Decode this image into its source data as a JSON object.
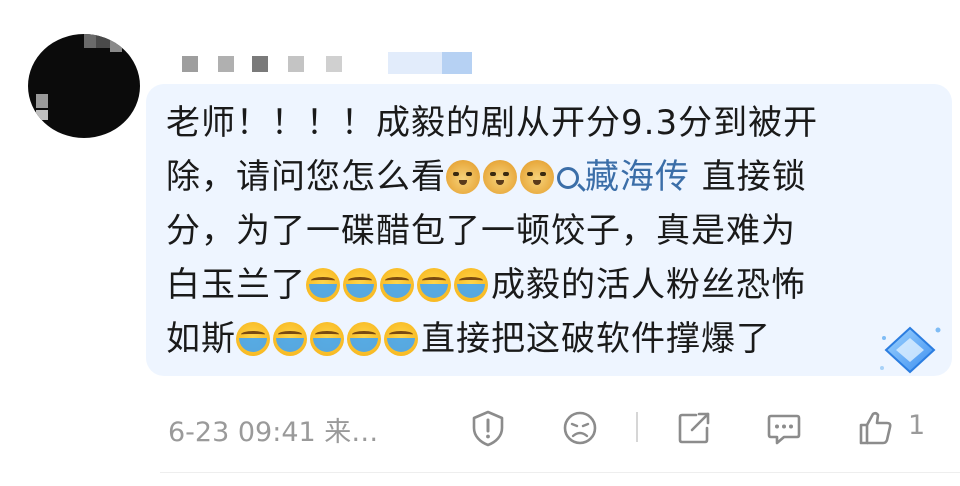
{
  "comment": {
    "line1": "老师！！！！成毅的剧从开分9.3分到被开",
    "line2a": "除，请问您怎么看",
    "topic": "藏海传",
    "line2b": " 直接锁",
    "line3": "分，为了一碟醋包了一顿饺子，真是难为",
    "line4a": "白玉兰了",
    "line4b": "成毅的活人粉丝恐怖",
    "line5a": "如斯",
    "line5b": "直接把这破软件撑爆了",
    "emojis": {
      "after_line2a": [
        "doge-icon",
        "doge-icon",
        "doge-icon"
      ],
      "after_line4a": [
        "cry-laugh-icon",
        "cry-laugh-icon",
        "cry-laugh-icon",
        "cry-laugh-icon",
        "cry-laugh-icon"
      ],
      "after_line5a": [
        "cry-laugh-icon",
        "cry-laugh-icon",
        "cry-laugh-icon",
        "cry-laugh-icon",
        "cry-laugh-icon"
      ]
    }
  },
  "footer": {
    "time": "6-23 09:41 来…",
    "like_count": "1",
    "icons": [
      "report-icon",
      "emoji-reaction-icon",
      "share-icon",
      "reply-icon",
      "like-icon"
    ]
  },
  "colors": {
    "bubble": "#eef5ff",
    "topic": "#3b6ea8",
    "meta_text": "#9a9a9a"
  }
}
